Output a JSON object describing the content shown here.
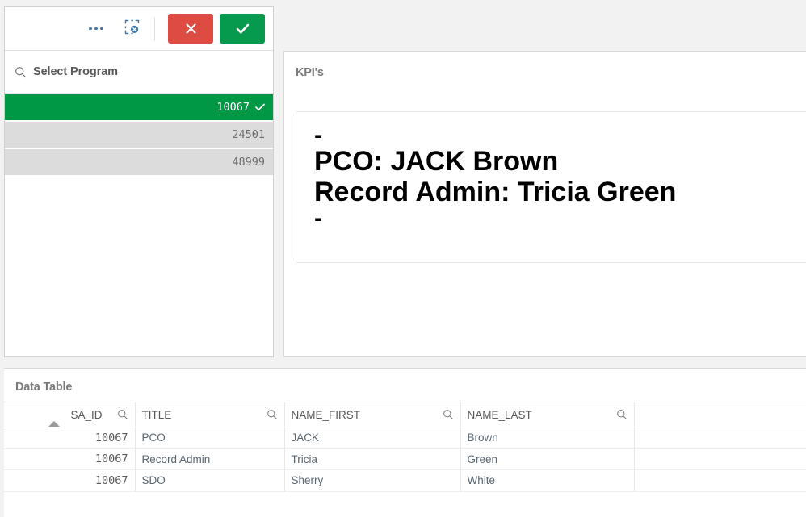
{
  "selection_panel": {
    "toolbar": {
      "more_label": "•••",
      "more_icon": "ellipsis-icon",
      "clear_selections_icon": "clear-selections-icon",
      "cancel_icon": "close-x-icon",
      "confirm_icon": "check-icon",
      "cancel_color": "#dd4b43",
      "confirm_color": "#069a4e"
    },
    "search": {
      "icon": "search-icon",
      "placeholder": "Select Program",
      "value": ""
    },
    "field_name": "Program",
    "items": [
      {
        "value": "10067",
        "state": "selected",
        "tick_icon": "check-icon"
      },
      {
        "value": "24501",
        "state": "alternative",
        "tick_icon": ""
      },
      {
        "value": "48999",
        "state": "alternative",
        "tick_icon": ""
      }
    ],
    "colors": {
      "selected_bg": "#009845",
      "selected_fg": "#ffffff",
      "alternative_bg": "#dcdcdc",
      "alternative_fg": "#6c6c6c"
    }
  },
  "kpi_panel": {
    "title": "KPI's",
    "lines": [
      {
        "text": "-",
        "size": "dash"
      },
      {
        "text": "PCO: JACK Brown",
        "size": "big"
      },
      {
        "text": "Record Admin: Tricia Green",
        "size": "big"
      },
      {
        "text": "-",
        "size": "dash"
      }
    ]
  },
  "data_table": {
    "title": "Data Table",
    "sort": {
      "column": "SA_ID",
      "direction": "ascending"
    },
    "search_icon": "search-icon",
    "columns": [
      {
        "label": "SA_ID",
        "align": "right",
        "searchable": true,
        "sorted": true
      },
      {
        "label": "TITLE",
        "align": "left",
        "searchable": true,
        "sorted": false
      },
      {
        "label": "NAME_FIRST",
        "align": "left",
        "searchable": true,
        "sorted": false
      },
      {
        "label": "NAME_LAST",
        "align": "left",
        "searchable": true,
        "sorted": false
      },
      {
        "label": "",
        "align": "left",
        "searchable": false,
        "sorted": false
      }
    ],
    "rows": [
      {
        "SA_ID": "10067",
        "TITLE": "PCO",
        "NAME_FIRST": "JACK",
        "NAME_LAST": "Brown",
        "BLANK": ""
      },
      {
        "SA_ID": "10067",
        "TITLE": "Record Admin",
        "NAME_FIRST": "Tricia",
        "NAME_LAST": "Green",
        "BLANK": ""
      },
      {
        "SA_ID": "10067",
        "TITLE": "SDO",
        "NAME_FIRST": "Sherry",
        "NAME_LAST": "White",
        "BLANK": ""
      }
    ]
  }
}
